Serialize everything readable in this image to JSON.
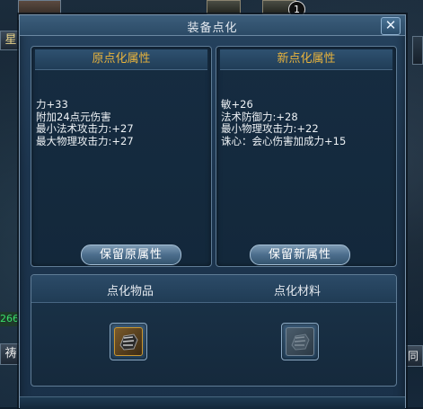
{
  "window": {
    "title": "装备点化",
    "close_symbol": "✕"
  },
  "background": {
    "left_tab": "星",
    "left_status": "266",
    "left_tab_bottom": "祷",
    "right_tab_bottom": "同",
    "badge_count": "1"
  },
  "original_panel": {
    "header": "原点化属性",
    "attributes": [
      "力+33",
      "附加24点元伤害",
      "最小法术攻击力:+27",
      "最大物理攻击力:+27"
    ],
    "button_label": "保留原属性"
  },
  "new_panel": {
    "header": "新点化属性",
    "attributes": [
      "敏+26",
      "法术防御力:+28",
      "最小物理攻击力:+22",
      "诛心：会心伤害加成力+15"
    ],
    "button_label": "保留新属性"
  },
  "materials": {
    "item_label": "点化物品",
    "material_label": "点化材料",
    "item_icon": "gauntlet-icon",
    "material_icon": "gauntlet-icon"
  },
  "colors": {
    "header_gold": "#e8b33c",
    "dialog_blue": "#1d3650",
    "text": "#eef2f5"
  }
}
